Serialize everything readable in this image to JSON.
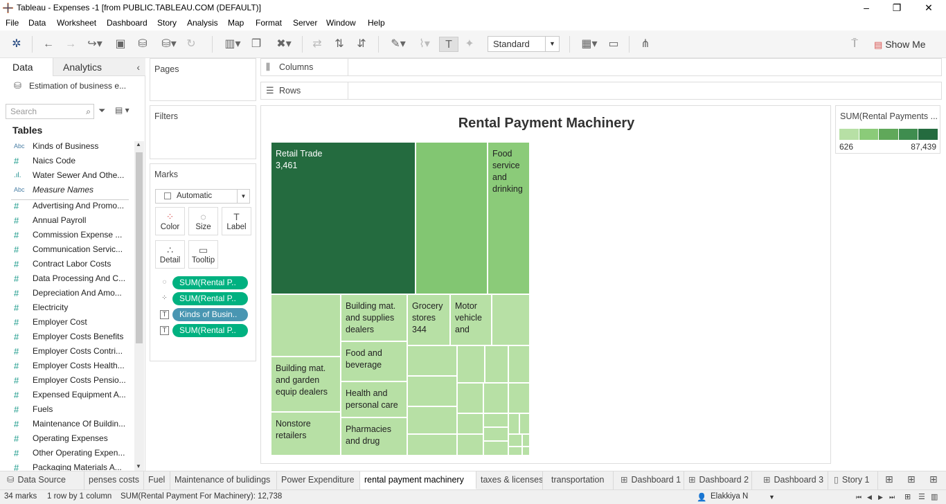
{
  "window": {
    "title": "Tableau - Expenses -1 [from PUBLIC.TABLEAU.COM (DEFAULT)]",
    "minimize": "–",
    "restore": "❐",
    "close": "✕"
  },
  "menu": [
    "File",
    "Data",
    "Worksheet",
    "Dashboard",
    "Story",
    "Analysis",
    "Map",
    "Format",
    "Server",
    "Window",
    "Help"
  ],
  "toolbar": {
    "fit_select": "Standard",
    "show_me": "Show Me"
  },
  "data_pane": {
    "tab_data": "Data",
    "tab_analytics": "Analytics",
    "collapse": "‹",
    "datasource": "Estimation of business e...",
    "search_placeholder": "Search",
    "tables_heading": "Tables",
    "fields": [
      {
        "type": "Abc",
        "name": "Kinds of Business",
        "italic": false
      },
      {
        "type": "#",
        "name": "Naics Code",
        "italic": false
      },
      {
        "type": ".ıl.",
        "name": "Water Sewer And Othe...",
        "italic": false
      },
      {
        "type": "Abc",
        "name": "Measure Names",
        "italic": true
      },
      {
        "type": "#",
        "name": "Advertising And Promo...",
        "italic": false
      },
      {
        "type": "#",
        "name": "Annual Payroll",
        "italic": false
      },
      {
        "type": "#",
        "name": "Commission Expense ...",
        "italic": false
      },
      {
        "type": "#",
        "name": "Communication Servic...",
        "italic": false
      },
      {
        "type": "#",
        "name": "Contract Labor Costs",
        "italic": false
      },
      {
        "type": "#",
        "name": "Data Processing And C...",
        "italic": false
      },
      {
        "type": "#",
        "name": "Depreciation And Amo...",
        "italic": false
      },
      {
        "type": "#",
        "name": "Electricity",
        "italic": false
      },
      {
        "type": "#",
        "name": "Employer Cost",
        "italic": false
      },
      {
        "type": "#",
        "name": "Employer Costs Benefits",
        "italic": false
      },
      {
        "type": "#",
        "name": "Employer Costs Contri...",
        "italic": false
      },
      {
        "type": "#",
        "name": "Employer Costs Health...",
        "italic": false
      },
      {
        "type": "#",
        "name": "Employer Costs Pensio...",
        "italic": false
      },
      {
        "type": "#",
        "name": "Expensed Equipment A...",
        "italic": false
      },
      {
        "type": "#",
        "name": "Fuels",
        "italic": false
      },
      {
        "type": "#",
        "name": "Maintenance Of Buildin...",
        "italic": false
      },
      {
        "type": "#",
        "name": "Operating Expenses",
        "italic": false
      },
      {
        "type": "#",
        "name": "Other Operating Expen...",
        "italic": false
      },
      {
        "type": "#",
        "name": "Packaging Materials A...",
        "italic": false
      }
    ]
  },
  "cards": {
    "pages": "Pages",
    "filters": "Filters",
    "marks": "Marks",
    "mark_type": "Automatic",
    "mark_buttons": [
      {
        "label": "Color",
        "glyph": "⁘"
      },
      {
        "label": "Size",
        "glyph": "◌"
      },
      {
        "label": "Label",
        "glyph": "T"
      },
      {
        "label": "Detail",
        "glyph": "∴"
      },
      {
        "label": "Tooltip",
        "glyph": "▭"
      }
    ],
    "pills": [
      {
        "icon": "◌",
        "text": "SUM(Rental P..",
        "color": "green"
      },
      {
        "icon": "⁘",
        "text": "SUM(Rental P..",
        "color": "green"
      },
      {
        "icon": "T",
        "text": "Kinds of Busin..",
        "color": "blue"
      },
      {
        "icon": "T",
        "text": "SUM(Rental P..",
        "color": "green"
      }
    ]
  },
  "shelves": {
    "columns": "Columns",
    "rows": "Rows"
  },
  "viz": {
    "title": "Rental Payment Machinery"
  },
  "chart_data": {
    "type": "treemap",
    "title": "Rental Payment Machinery",
    "labeled_tiles": [
      {
        "label": "Retail Trade",
        "value": "3,461",
        "color": "#246b3f"
      },
      {
        "label": "",
        "value": "",
        "color": "#82c672"
      },
      {
        "label": "Food service and drinking",
        "value": "",
        "color": "#8bcb79"
      },
      {
        "label": "Building mat. and supplies dealers",
        "value": "",
        "color": "#b7e0a5"
      },
      {
        "label": "Grocery stores",
        "value": "344",
        "color": "#b7e0a5"
      },
      {
        "label": "Motor vehicle and",
        "value": "",
        "color": "#b7e0a5"
      },
      {
        "label": "Food and beverage",
        "value": "",
        "color": "#b7e0a5"
      },
      {
        "label": "Building mat. and garden equip dealers",
        "value": "",
        "color": "#b7e0a5"
      },
      {
        "label": "Health and personal care",
        "value": "",
        "color": "#b7e0a5"
      },
      {
        "label": "Nonstore retailers",
        "value": "",
        "color": "#b7e0a5"
      },
      {
        "label": "Pharmacies and drug",
        "value": "",
        "color": "#b7e0a5"
      }
    ],
    "legend": {
      "title": "SUM(Rental Payments ...",
      "min": "626",
      "max": "87,439",
      "ramp": [
        "#b7e0a5",
        "#8bcb79",
        "#60a85a",
        "#3f8d4f",
        "#246b3f"
      ]
    }
  },
  "sheet_tabs": [
    {
      "label": "Data Source",
      "icon": "⛁",
      "active": false
    },
    {
      "label": "penses costs",
      "icon": "",
      "active": false
    },
    {
      "label": "Fuel",
      "icon": "",
      "active": false
    },
    {
      "label": "Maintenance of bulidings",
      "icon": "",
      "active": false
    },
    {
      "label": "Power Expenditure",
      "icon": "",
      "active": false
    },
    {
      "label": "rental payment machinery",
      "icon": "",
      "active": true
    },
    {
      "label": "taxes & licenses",
      "icon": "",
      "active": false
    },
    {
      "label": "transportation",
      "icon": "",
      "active": false
    },
    {
      "label": "Dashboard 1",
      "icon": "⊞",
      "active": false
    },
    {
      "label": "Dashboard 2",
      "icon": "⊞",
      "active": false
    },
    {
      "label": "Dashboard 3",
      "icon": "⊞",
      "active": false
    },
    {
      "label": "Story 1",
      "icon": "▯",
      "active": false
    }
  ],
  "status": {
    "marks": "34 marks",
    "layout": "1 row by 1 column",
    "sum": "SUM(Rental Payment For Machinery): 12,738",
    "user": "Elakkiya N"
  }
}
